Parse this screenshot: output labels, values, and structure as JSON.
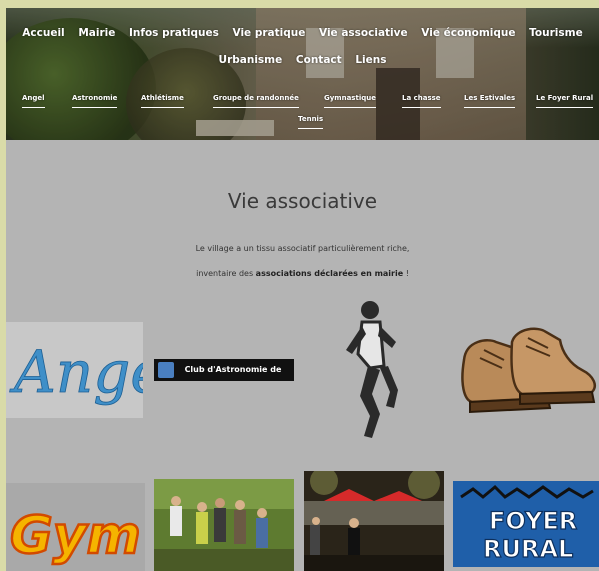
{
  "nav_main": {
    "row1": [
      "Accueil",
      "Mairie",
      "Infos pratiques",
      "Vie pratique",
      "Vie associative",
      "Vie économique",
      "Tourisme"
    ],
    "row2": [
      "Urbanisme",
      "Contact",
      "Liens"
    ]
  },
  "nav_sub": {
    "items": [
      "Angel",
      "Astronomie",
      "Athlétisme",
      "Groupe de randonnée",
      "Gymnastique",
      "La chasse",
      "Les Estivales",
      "Le Foyer Rural",
      "Tennis"
    ]
  },
  "page": {
    "title": "Vie associative",
    "intro_line1": "Le village a un tissu associatif particulièrement riche,",
    "intro_line2_before": "inventaire des ",
    "intro_line2_bold": "associations déclarées en mairie",
    "intro_line2_after": " !"
  },
  "tiles": {
    "angel_logo": "Angel",
    "astro_logo": "Club d'Astronomie de Gigouzac",
    "gym_logo": "Gym",
    "foyer_logo_line1": "FOYER",
    "foyer_logo_line2": "RURAL"
  },
  "colors": {
    "page_bg": "#b4b4b4",
    "outer_bg": "#d9dba8",
    "title_text": "#3a3a3a"
  }
}
